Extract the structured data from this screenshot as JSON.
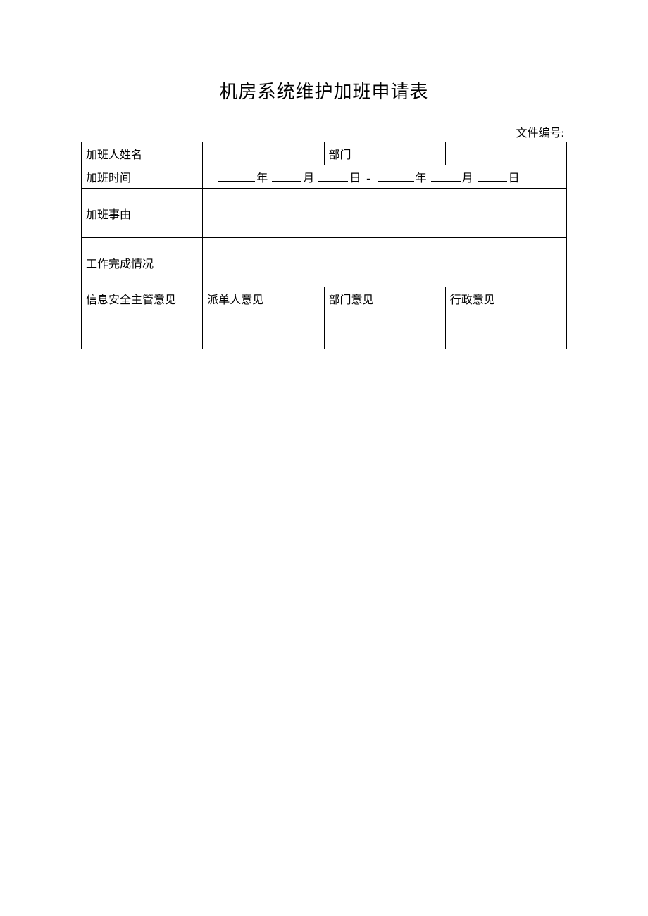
{
  "title": "机房系统维护加班申请表",
  "doc_number_label": "文件编号:",
  "labels": {
    "name": "加班人姓名",
    "dept": "部门",
    "time": "加班时间",
    "reason": "加班事由",
    "completion": "工作完成情况",
    "security_opinion": "信息安全主管意见",
    "dispatcher_opinion": "派单人意见",
    "dept_opinion": "部门意见",
    "admin_opinion": "行政意见"
  },
  "date": {
    "year": "年",
    "month": "月",
    "day": "日",
    "sep": "-"
  },
  "values": {
    "name": "",
    "dept": "",
    "reason": "",
    "completion": "",
    "security_opinion": "",
    "dispatcher_opinion": "",
    "dept_opinion": "",
    "admin_opinion": ""
  }
}
